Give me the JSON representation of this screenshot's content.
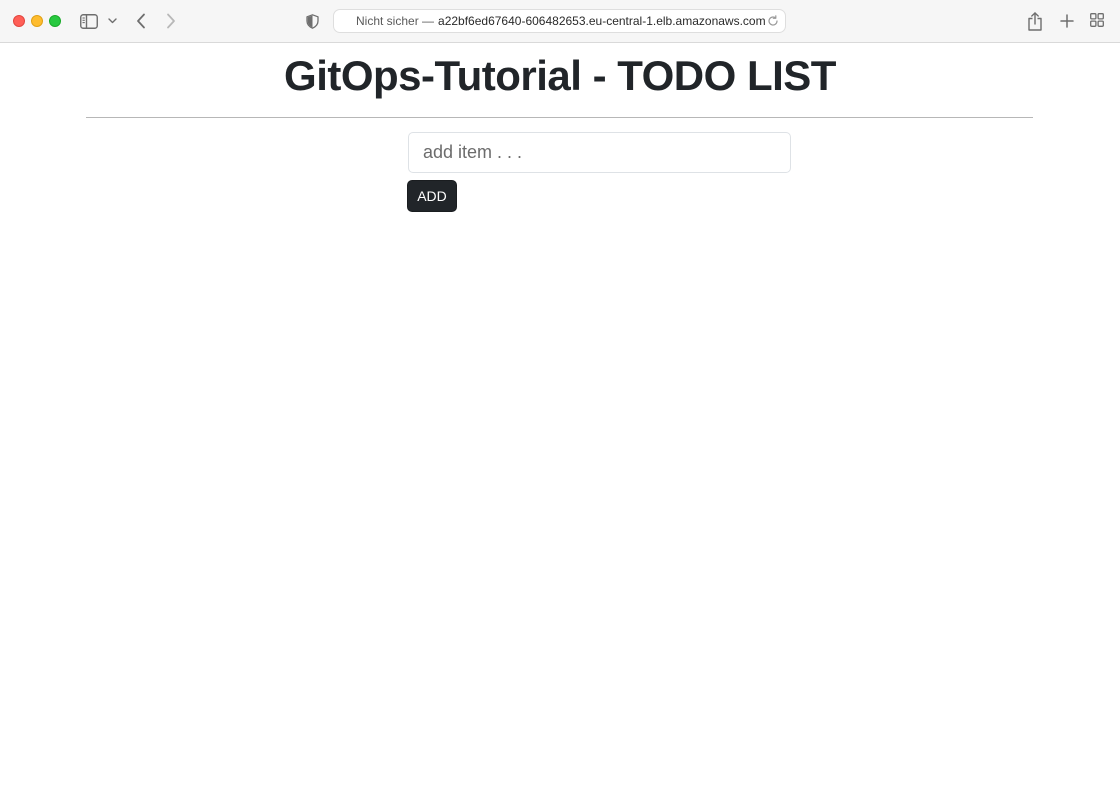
{
  "browser": {
    "security_label": "Nicht sicher —",
    "url": "a22bf6ed67640-606482653.eu-central-1.elb.amazonaws.com",
    "icons": {
      "sidebar": "sidebar-icon",
      "sidebar_menu": "chevron-down-icon",
      "back": "chevron-left-icon",
      "forward": "chevron-right-icon",
      "privacy": "shield-icon",
      "reload": "reload-icon",
      "share": "share-icon",
      "new_tab": "plus-icon",
      "tab_overview": "grid-icon"
    },
    "colors": {
      "close": "#ff5f57",
      "minimize": "#febc2e",
      "zoom": "#28c840"
    }
  },
  "page": {
    "title": "GitOps-Tutorial - TODO LIST",
    "input": {
      "value": "",
      "placeholder": "add item . . ."
    },
    "add_button_label": "ADD",
    "colors": {
      "text": "#212529",
      "button_bg": "#212529",
      "button_text": "#ffffff"
    }
  }
}
